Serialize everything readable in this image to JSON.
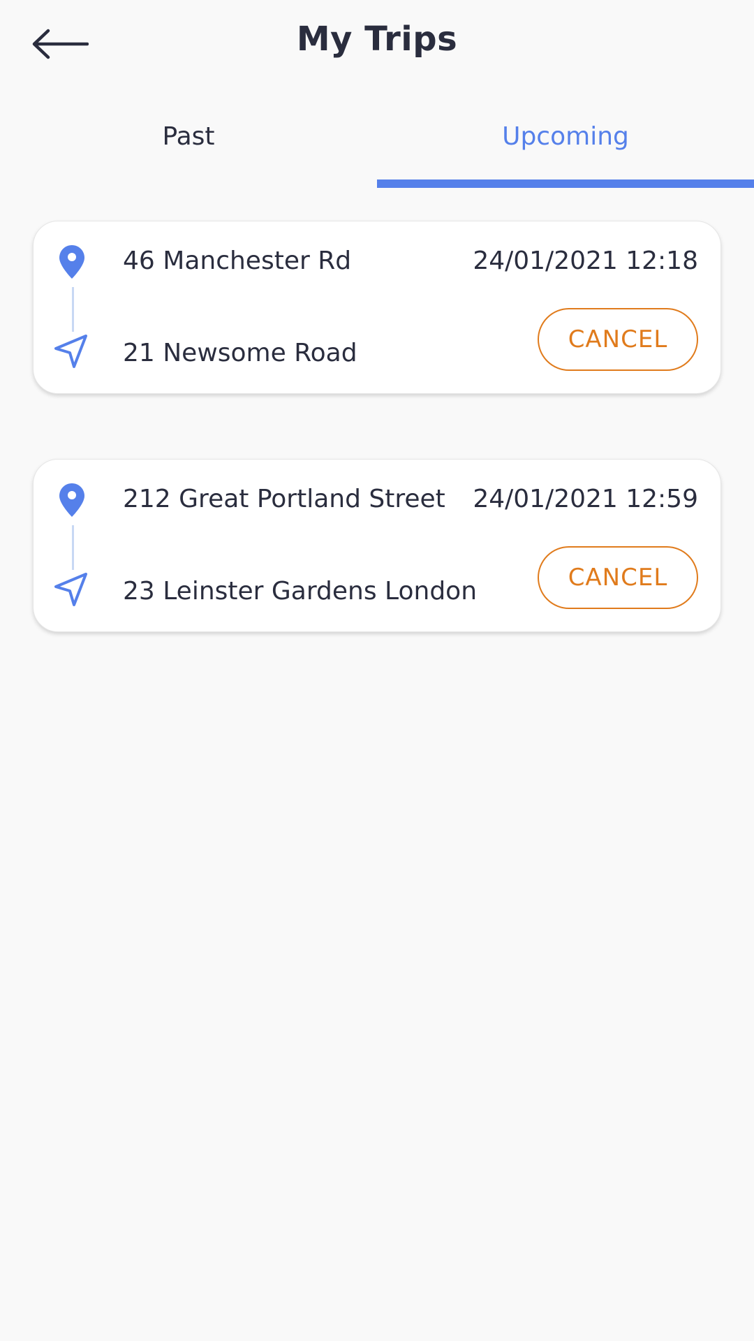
{
  "header": {
    "title": "My Trips",
    "back_icon": "arrow-left-icon"
  },
  "tabs": [
    {
      "label": "Past",
      "active": false
    },
    {
      "label": "Upcoming",
      "active": true
    }
  ],
  "colors": {
    "accent": "#5580ea",
    "cancel": "#e07b1c",
    "text": "#2a2d3e",
    "route_line": "#c8d8f4"
  },
  "trips": [
    {
      "origin": "46 Manchester Rd",
      "destination": "21 Newsome Road",
      "datetime": "24/01/2021 12:18",
      "cancel_label": "CANCEL",
      "origin_icon": "location-pin-icon",
      "destination_icon": "navigation-arrow-icon"
    },
    {
      "origin": "212 Great Portland Street",
      "destination": "23 Leinster Gardens London",
      "datetime": "24/01/2021 12:59",
      "cancel_label": "CANCEL",
      "origin_icon": "location-pin-icon",
      "destination_icon": "navigation-arrow-icon"
    }
  ]
}
